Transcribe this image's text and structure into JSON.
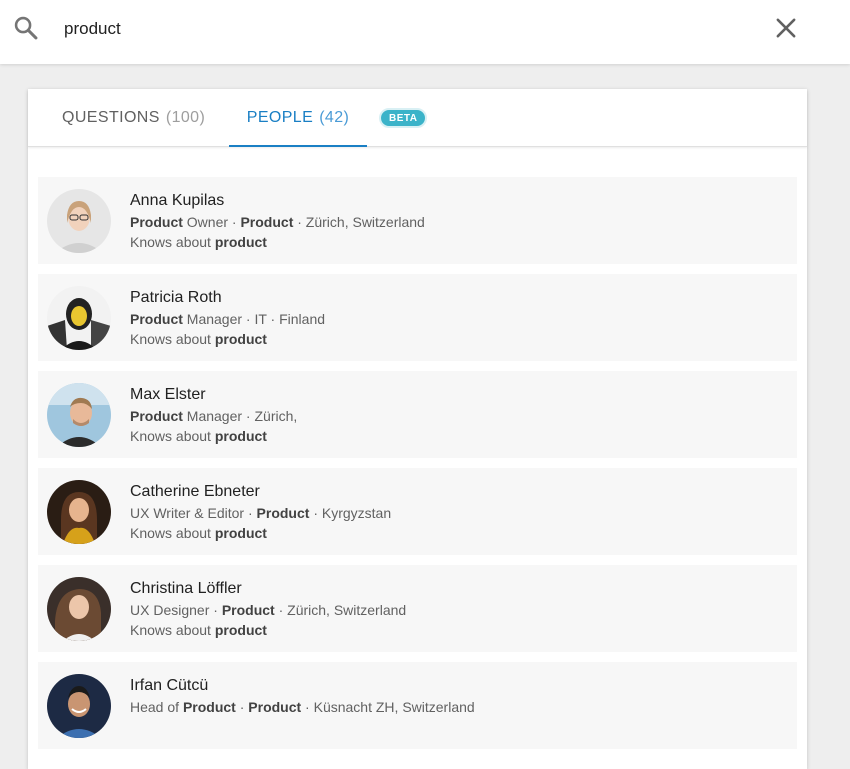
{
  "search": {
    "value": "product",
    "icon": "search-icon",
    "close_icon": "close-icon"
  },
  "tabs": [
    {
      "label": "QUESTIONS",
      "count": "(100)",
      "active": false
    },
    {
      "label": "PEOPLE",
      "count": "(42)",
      "active": true
    }
  ],
  "beta_label": "BETA",
  "colors": {
    "accent": "#1a7fc4",
    "beta": "#3bb3c9",
    "row_bg": "#f7f7f7"
  },
  "people": [
    {
      "name": "Anna Kupilas",
      "l2": [
        {
          "t": "Product",
          "b": true
        },
        {
          "t": " Owner · ",
          "b": false
        },
        {
          "t": "Product",
          "b": true
        },
        {
          "t": " · Zürich, Switzerland",
          "b": false
        }
      ],
      "l3": [
        {
          "t": "Knows about ",
          "b": false
        },
        {
          "t": "product",
          "b": true
        }
      ]
    },
    {
      "name": "Patricia Roth",
      "l2": [
        {
          "t": "Product",
          "b": true
        },
        {
          "t": " Manager · IT · Finland",
          "b": false
        }
      ],
      "l3": [
        {
          "t": "Knows about ",
          "b": false
        },
        {
          "t": "product",
          "b": true
        }
      ]
    },
    {
      "name": "Max Elster",
      "l2": [
        {
          "t": "Product",
          "b": true
        },
        {
          "t": " Manager · Zürich,",
          "b": false
        }
      ],
      "l3": [
        {
          "t": "Knows about ",
          "b": false
        },
        {
          "t": "product",
          "b": true
        }
      ]
    },
    {
      "name": "Catherine Ebneter",
      "l2": [
        {
          "t": "UX Writer & Editor · ",
          "b": false
        },
        {
          "t": "Product",
          "b": true
        },
        {
          "t": " · Kyrgyzstan",
          "b": false
        }
      ],
      "l3": [
        {
          "t": "Knows about ",
          "b": false
        },
        {
          "t": "product",
          "b": true
        }
      ]
    },
    {
      "name": "Christina Löffler",
      "l2": [
        {
          "t": "UX Designer · ",
          "b": false
        },
        {
          "t": "Product",
          "b": true
        },
        {
          "t": " · Zürich, Switzerland",
          "b": false
        }
      ],
      "l3": [
        {
          "t": "Knows about ",
          "b": false
        },
        {
          "t": "product",
          "b": true
        }
      ]
    },
    {
      "name": "Irfan Cütcü",
      "l2": [
        {
          "t": "Head of ",
          "b": false
        },
        {
          "t": "Product",
          "b": true
        },
        {
          "t": " · ",
          "b": false
        },
        {
          "t": "Product",
          "b": true
        },
        {
          "t": " · Küsnacht ZH, Switzerland",
          "b": false
        }
      ],
      "l3": []
    }
  ]
}
